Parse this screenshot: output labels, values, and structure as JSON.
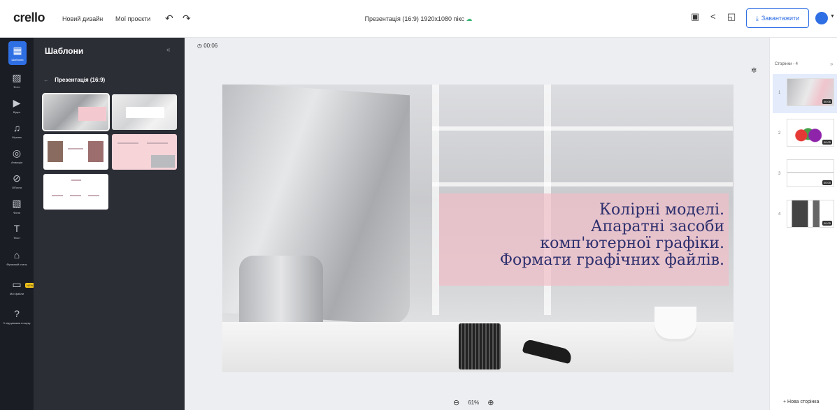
{
  "app": {
    "logo": "crello"
  },
  "topbar": {
    "new_design": "Новий дизайн",
    "my_projects": "Мої проєкти",
    "doc_title": "Презентація (16:9) 1920x1080 пікс",
    "download_label": "Завантажити"
  },
  "rail": {
    "items": [
      {
        "label": "Шаблони",
        "icon": "templates-icon"
      },
      {
        "label": "Фото",
        "icon": "photo-icon"
      },
      {
        "label": "Відео",
        "icon": "video-icon"
      },
      {
        "label": "Музика",
        "icon": "music-icon"
      },
      {
        "label": "Анімація",
        "icon": "animation-icon"
      },
      {
        "label": "Об'єкти",
        "icon": "objects-icon"
      },
      {
        "label": "Фони",
        "icon": "backgrounds-icon"
      },
      {
        "label": "Текст",
        "icon": "text-icon"
      },
      {
        "label": "Фірмовий стиль",
        "icon": "brand-kit-icon"
      },
      {
        "label": "Мої файли",
        "icon": "folder-icon"
      },
      {
        "label": "З підсумками пошуку",
        "icon": "help-icon"
      }
    ],
    "new_badge": "NEW"
  },
  "panel": {
    "title": "Шаблони",
    "subhead": "Презентація (16:9)"
  },
  "canvas": {
    "timer": "00:06",
    "slide_text": [
      "Колірні моделі.",
      "Апаратні засоби",
      "комп'ютерної графіки.",
      "Формати графічних файлів."
    ],
    "zoom": "61%"
  },
  "pages": {
    "title": "Сторінки - 4",
    "items": [
      {
        "num": "1",
        "duration": "00:06"
      },
      {
        "num": "2",
        "duration": "00:05"
      },
      {
        "num": "3",
        "duration": "00:05"
      },
      {
        "num": "4",
        "duration": "00:05"
      }
    ],
    "new_page": "+ Нова сторінка"
  },
  "colors": {
    "accent": "#2f6fe4",
    "slide_text": "#2d2f6e",
    "slide_pink": "#f0bec8"
  }
}
